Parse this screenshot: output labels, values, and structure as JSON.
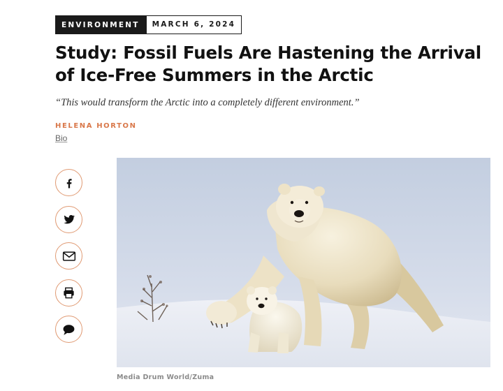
{
  "article": {
    "category": "ENVIRONMENT",
    "date": "MARCH 6, 2024",
    "headline": "Study: Fossil Fuels Are Hastening the Arrival of Ice-Free Summers in the Arctic",
    "dek": "“This would transform the Arctic into a completely different environment.”",
    "author": "HELENA HORTON",
    "bio_link": "Bio"
  },
  "share": [
    {
      "icon": "facebook-icon"
    },
    {
      "icon": "twitter-icon"
    },
    {
      "icon": "email-icon"
    },
    {
      "icon": "print-icon"
    },
    {
      "icon": "comment-icon"
    }
  ],
  "image": {
    "credit": "Media Drum World/Zuma"
  },
  "colors": {
    "accent": "#d9784a",
    "share_border": "#e09a73",
    "tag_dark": "#1a1a1a"
  }
}
